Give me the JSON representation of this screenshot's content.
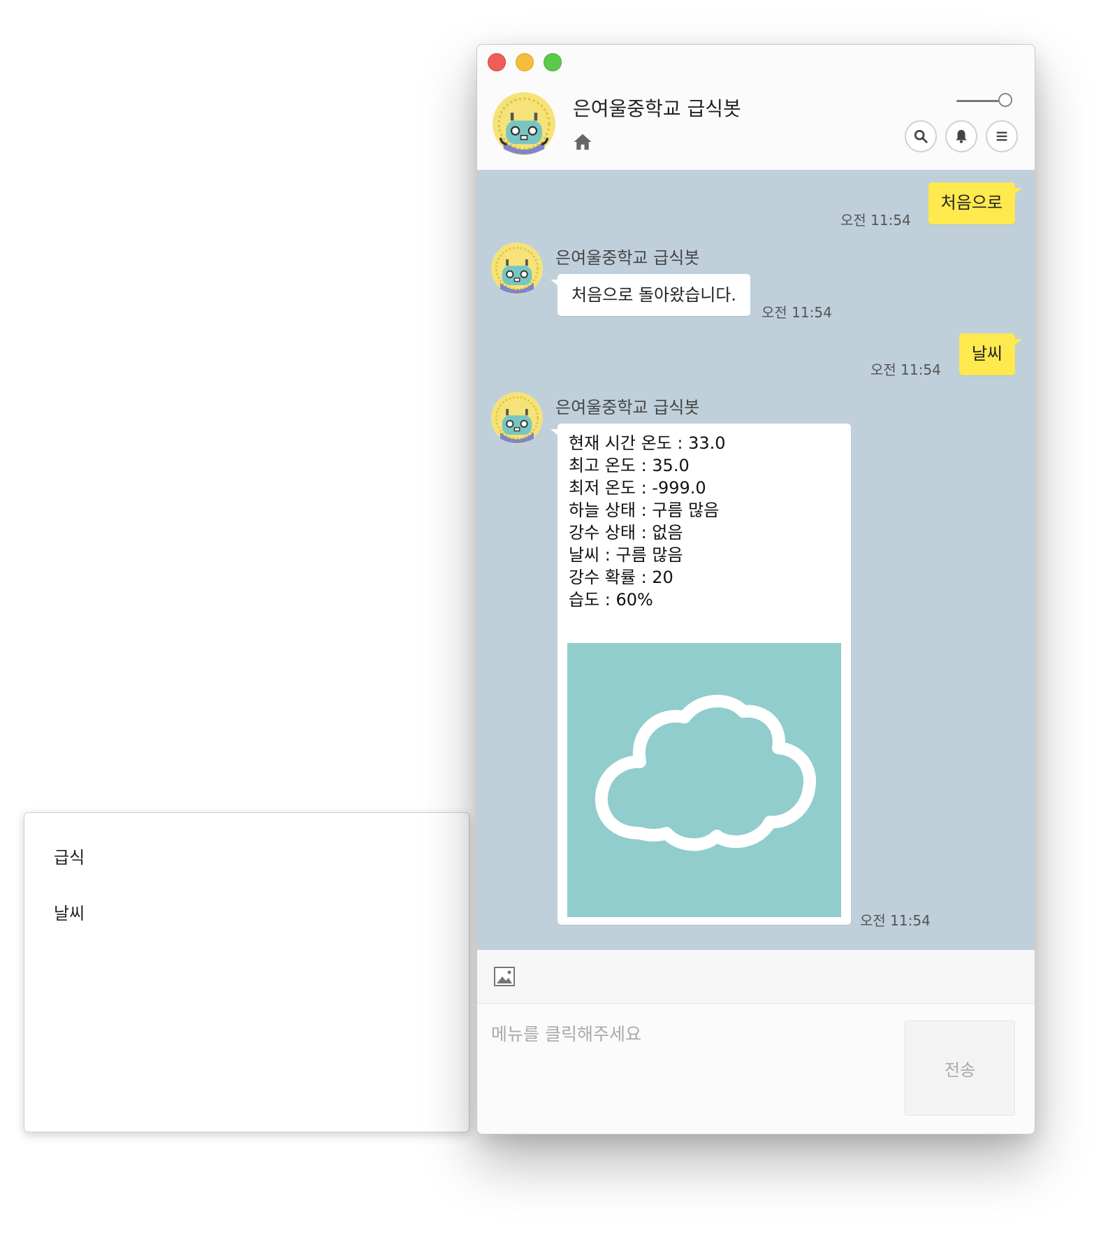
{
  "window": {
    "title": "은여울중학교 급식봇"
  },
  "colors": {
    "chat_background": "#bfd0db",
    "my_bubble": "#fee94e",
    "bot_bubble": "#ffffff",
    "weather_image_bg": "#90cdcc"
  },
  "header": {
    "icons": [
      "home-icon",
      "search-icon",
      "bell-icon",
      "hamburger-menu-icon"
    ]
  },
  "messages": [
    {
      "from": "me",
      "text": "처음으로",
      "time": "오전 11:54"
    },
    {
      "from": "bot",
      "sender": "은여울중학교 급식봇",
      "text": "처음으로 돌아왔습니다.",
      "time": "오전 11:54"
    },
    {
      "from": "me",
      "text": "날씨",
      "time": "오전 11:54"
    },
    {
      "from": "bot",
      "sender": "은여울중학교 급식봇",
      "lines": [
        "현재 시간 온도 : 33.0",
        "최고 온도 : 35.0",
        "최저 온도 : -999.0",
        "하늘 상태 : 구름 많음",
        "강수 상태 : 없음",
        "날씨 : 구름 많음",
        "강수 확률 : 20",
        "습도 : 60%"
      ],
      "image_icon": "cloud-icon",
      "time": "오전 11:54"
    }
  ],
  "input": {
    "placeholder": "메뉴를 클릭해주세요",
    "value": "",
    "send_label": "전송"
  },
  "menu_panel": {
    "items": [
      "급식",
      "날씨"
    ]
  }
}
